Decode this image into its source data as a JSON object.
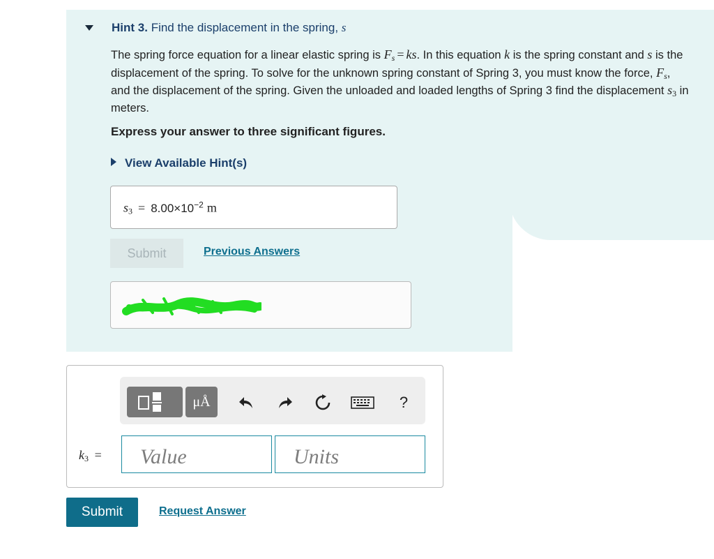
{
  "hint": {
    "label": "Hint 3.",
    "title": "Find the displacement in the spring,",
    "title_var": "s",
    "body": {
      "p1": "The spring force equation for a linear elastic spring is",
      "p2": ". In this equation",
      "p3": "is the spring constant and",
      "p4": "is the displacement of the spring. To solve for the unknown spring constant of Spring 3, you must know the force,",
      "p5": ", and the displacement of the spring. Given the unloaded and loaded lengths of Spring 3 find the displacement",
      "p6": "in meters."
    },
    "instruction": "Express your answer to three significant figures.",
    "view_hints": "View Available Hint(s)",
    "answer": {
      "var": "s",
      "sub": "3",
      "eq": "=",
      "mantissa": "8.00×10",
      "exponent": "−2",
      "unit": "m"
    },
    "submit_label": "Submit",
    "previous_answers": "Previous Answers"
  },
  "input": {
    "toolbar": {
      "units_button": "μÅ",
      "help": "?"
    },
    "var": "k",
    "sub": "3",
    "eq": "=",
    "value_placeholder": "Value",
    "units_placeholder": "Units"
  },
  "actions": {
    "submit": "Submit",
    "request_answer": "Request Answer"
  },
  "colors": {
    "hint_bg": "#e6f4f4",
    "link": "#0e6f8e",
    "submit_bg": "#0f6d8a",
    "field_border": "#1a8aa0",
    "redaction": "#22dd22"
  }
}
